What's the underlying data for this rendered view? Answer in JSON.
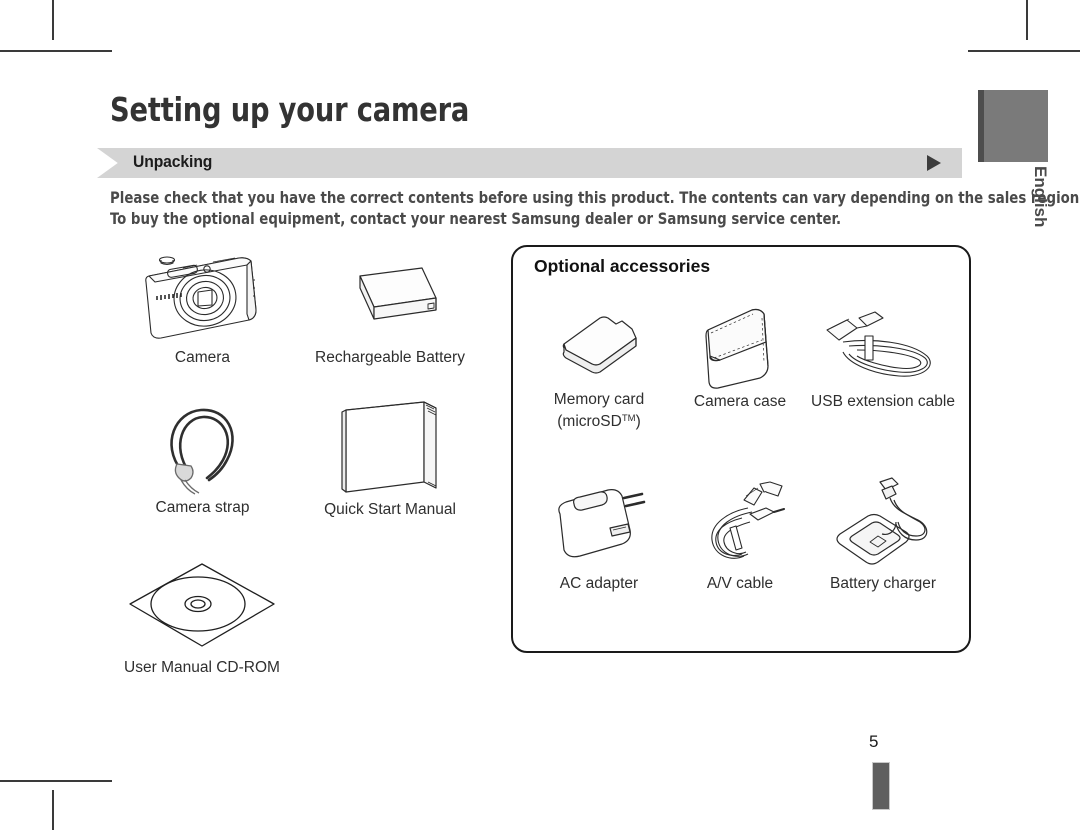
{
  "document": {
    "page_title": "Setting up your camera",
    "page_number": "5",
    "language_tab": "English"
  },
  "section": {
    "heading": "Unpacking",
    "arrow_icon": "triangle-right-icon"
  },
  "intro": {
    "line1": "Please check that you have the correct contents before using this product. The contents can vary depending on the sales region.",
    "line2": "To buy the optional equipment, contact your nearest Samsung dealer or Samsung service center."
  },
  "included_items": [
    {
      "id": "camera",
      "caption": "Camera",
      "icon": "camera-illustration"
    },
    {
      "id": "battery",
      "caption": "Rechargeable Battery",
      "icon": "battery-illustration"
    },
    {
      "id": "strap",
      "caption": "Camera strap",
      "icon": "camera-strap-illustration"
    },
    {
      "id": "manual",
      "caption": "Quick Start Manual",
      "icon": "booklet-illustration"
    },
    {
      "id": "cdrom",
      "caption": "User Manual CD-ROM",
      "icon": "cd-rom-illustration"
    }
  ],
  "optional": {
    "title": "Optional accessories",
    "items": [
      {
        "id": "memory-card",
        "caption": "Memory card",
        "caption2": "(microSD",
        "trademark": "TM",
        "caption3": ")",
        "icon": "memory-card-illustration"
      },
      {
        "id": "camera-case",
        "caption": "Camera case",
        "icon": "camera-case-illustration"
      },
      {
        "id": "usb-cable",
        "caption": "USB extension cable",
        "icon": "usb-cable-illustration"
      },
      {
        "id": "ac-adapter",
        "caption": "AC adapter",
        "icon": "ac-adapter-illustration"
      },
      {
        "id": "av-cable",
        "caption": "A/V cable",
        "icon": "av-cable-illustration"
      },
      {
        "id": "battery-charger",
        "caption": "Battery charger",
        "icon": "battery-charger-illustration"
      }
    ]
  },
  "colors": {
    "section_bar": "#d4d4d4",
    "title_text": "#333333",
    "body_text": "#4a4a4a",
    "tab_gray": "#7a7a7a",
    "tab_edge": "#4d4d4d",
    "panel_border": "#1a1a1a"
  }
}
